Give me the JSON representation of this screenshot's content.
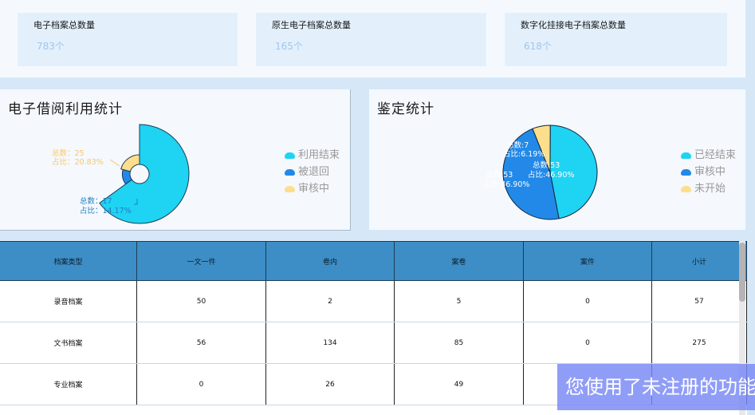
{
  "stats": [
    {
      "label": "电子档案总数量",
      "value": "783个"
    },
    {
      "label": "原生电子档案总数量",
      "value": "165个"
    },
    {
      "label": "数字化挂接电子档案总数量",
      "value": "618个"
    }
  ],
  "borrow_panel": {
    "title": "电子借阅利用统计",
    "annotations": [
      {
        "line1": "总数：25",
        "line2": "占比：20.83%",
        "color": "#f5d27a"
      },
      {
        "line1": "总数：17",
        "line2": "占比：14.17%",
        "color": "#2e8fcf"
      }
    ],
    "legend": [
      {
        "label": "利用结束",
        "color": "#1fd3f2"
      },
      {
        "label": "被退回",
        "color": "#2289e8"
      },
      {
        "label": "审核中",
        "color": "#fdde8c"
      }
    ]
  },
  "appraisal_panel": {
    "title": "鉴定统计",
    "slice_labels": [
      {
        "line1": "总数:7",
        "line2": "占比:6.19%"
      },
      {
        "line1": "总数:53",
        "line2": "占比:46.90%"
      },
      {
        "line1": "总数:53",
        "line2": "占比:46.90%"
      }
    ],
    "legend": [
      {
        "label": "已经结束",
        "color": "#1fd3f2"
      },
      {
        "label": "审核中",
        "color": "#2289e8"
      },
      {
        "label": "未开始",
        "color": "#fdde8c"
      }
    ]
  },
  "chart_data": [
    {
      "type": "pie",
      "title": "电子借阅利用统计",
      "labels": [
        "利用结束",
        "被退回",
        "审核中"
      ],
      "values": [
        78,
        17,
        25
      ],
      "colors": [
        "#1fd3f2",
        "#2289e8",
        "#fdde8c"
      ]
    },
    {
      "type": "pie",
      "title": "鉴定统计",
      "labels": [
        "已经结束",
        "审核中",
        "未开始"
      ],
      "values": [
        53,
        53,
        7
      ],
      "colors": [
        "#1fd3f2",
        "#2289e8",
        "#fdde8c"
      ]
    }
  ],
  "table": {
    "headers": [
      "档案类型",
      "一文一件",
      "卷内",
      "案卷",
      "案件",
      "小计"
    ],
    "rows": [
      [
        "录音档案",
        "50",
        "2",
        "5",
        "0",
        "57"
      ],
      [
        "文书档案",
        "56",
        "134",
        "85",
        "0",
        "275"
      ],
      [
        "专业档案",
        "0",
        "26",
        "49",
        "",
        ""
      ]
    ]
  },
  "watermark": "您使用了未注册的功能"
}
